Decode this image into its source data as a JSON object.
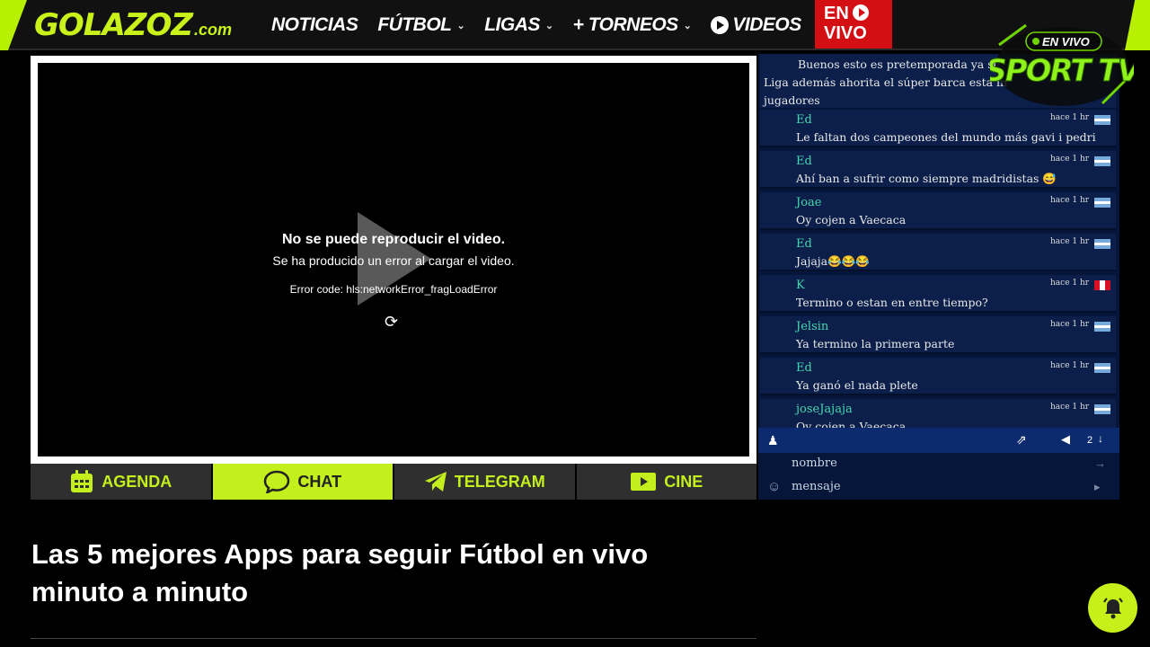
{
  "header": {
    "logo_main": "GOLAZOZ",
    "logo_domain": ".com",
    "nav": [
      {
        "label": "NOTICIAS",
        "has_dropdown": false
      },
      {
        "label": "FÚTBOL",
        "has_dropdown": true
      },
      {
        "label": "LIGAS",
        "has_dropdown": true
      },
      {
        "label": "+ TORNEOS",
        "has_dropdown": true
      },
      {
        "label": "VIDEOS",
        "has_dropdown": false
      }
    ],
    "live_button_line1": "EN",
    "live_button_line2": "VIVO"
  },
  "player": {
    "error_title": "No se puede reproducir el video.",
    "error_subtitle": "Se ha producido un error al cargar el video.",
    "error_code": "Error code: hls:networkError_fragLoadError"
  },
  "tabs": [
    {
      "label": "AGENDA",
      "icon": "calendar-icon"
    },
    {
      "label": "CHAT",
      "icon": "chat-bubble-icon"
    },
    {
      "label": "TELEGRAM",
      "icon": "telegram-icon"
    },
    {
      "label": "CINE",
      "icon": "movie-icon"
    }
  ],
  "chat": {
    "first_message": {
      "line1": "Buenos esto es pretemporada ya se",
      "line2": "Liga además ahorita el súper barca esta in",
      "line3": "jugadores"
    },
    "messages": [
      {
        "user": "Ed",
        "text": "Le faltan dos campeones del mundo más gavi i pedri",
        "time": "hace 1 hr",
        "flag": "argentina"
      },
      {
        "user": "Ed",
        "text": "Ahí ban a sufrir como siempre madridistas 😅",
        "time": "hace 1 hr",
        "flag": "argentina"
      },
      {
        "user": "Joae",
        "text": "Oy cojen a Vaecaca",
        "time": "hace 1 hr",
        "flag": "argentina"
      },
      {
        "user": "Ed",
        "text": "Jajaja😂😂😂",
        "time": "hace 1 hr",
        "flag": "argentina"
      },
      {
        "user": "K",
        "text": "Termino o estan en entre tiempo?",
        "time": "hace 1 hr",
        "flag": "peru"
      },
      {
        "user": "Jelsin",
        "text": "Ya termino la primera parte",
        "time": "hace 1 hr",
        "flag": "argentina"
      },
      {
        "user": "Ed",
        "text": "Ya ganó el nada plete",
        "time": "hace 1 hr",
        "flag": "argentina"
      },
      {
        "user": "joseJajaja",
        "text": "Oy cojen a Vaecaca",
        "time": "hace 1 hr",
        "flag": "argentina"
      }
    ],
    "online_count": "2",
    "name_placeholder": "nombre",
    "message_placeholder": "mensaje"
  },
  "sport_logo": {
    "badge": "EN VIVO",
    "name": "SPORT TV"
  },
  "article": {
    "title": "Las 5 mejores Apps para seguir Fútbol en vivo minuto a minuto"
  },
  "colors": {
    "accent": "#c3ef1c",
    "live_red": "#d40f14",
    "chat_bg": "#05163a",
    "chat_msg_bg": "#0b1f4a",
    "chat_user": "#47d6b0"
  }
}
